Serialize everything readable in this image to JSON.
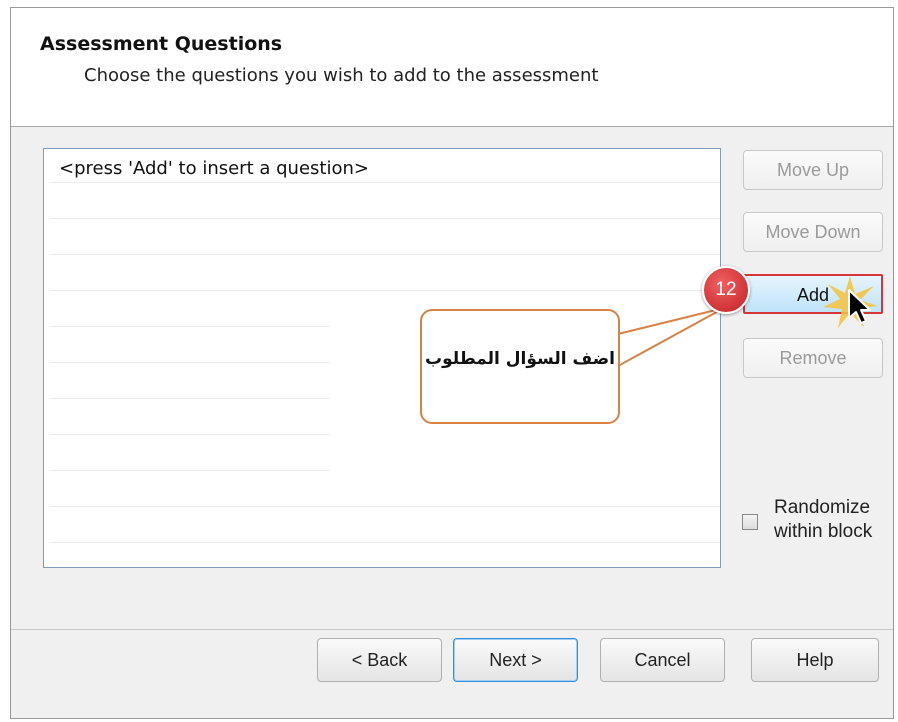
{
  "header": {
    "title": "Assessment Questions",
    "subtitle": "Choose the questions you wish to add to the assessment"
  },
  "question_list": {
    "placeholder": "<press 'Add' to insert a question>"
  },
  "side_buttons": {
    "move_up": "Move Up",
    "move_down": "Move Down",
    "add": "Add",
    "remove": "Remove"
  },
  "randomize": {
    "label_line1": "Randomize",
    "label_line2": "within block",
    "checked": false
  },
  "footer": {
    "back": "< Back",
    "next": "Next >",
    "cancel": "Cancel",
    "help": "Help"
  },
  "annotation": {
    "step_number": "12",
    "callout_text": "اضف السؤال المطلوب",
    "accent_color": "#d4363a",
    "callout_border_color": "#d98245"
  }
}
